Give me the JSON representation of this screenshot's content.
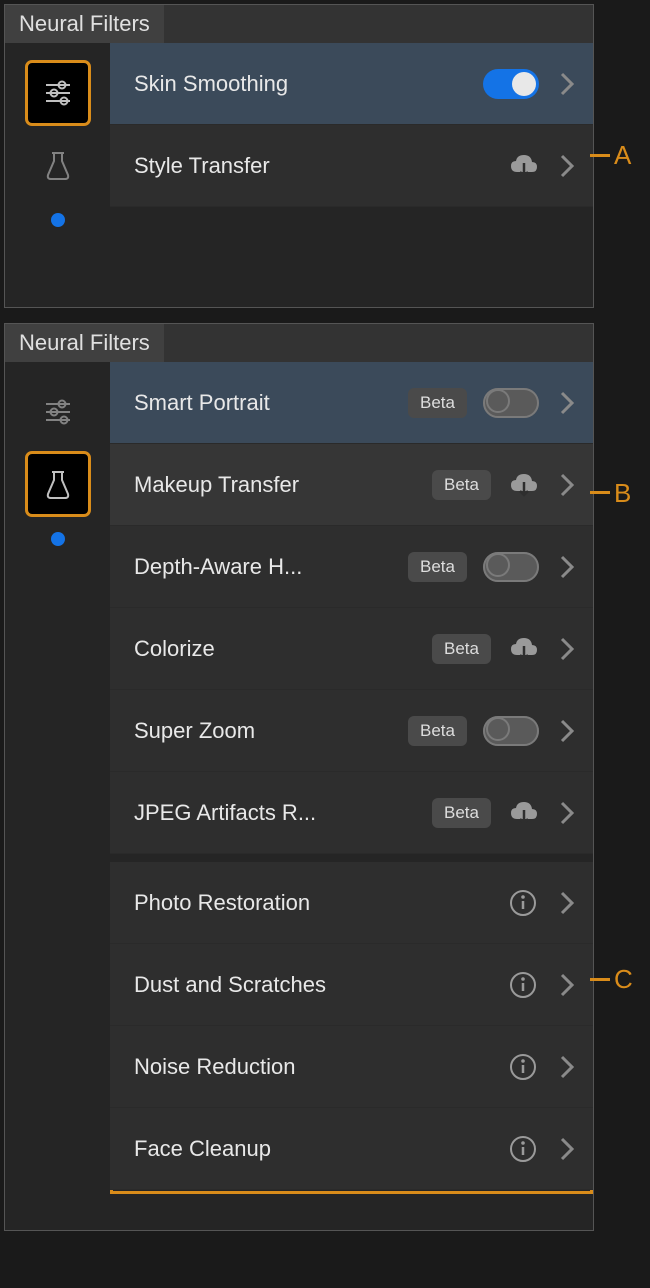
{
  "panel1": {
    "title": "Neural Filters",
    "rows": [
      {
        "label": "Skin Smoothing",
        "control": "toggle-on"
      },
      {
        "label": "Style Transfer",
        "control": "cloud"
      }
    ]
  },
  "panel2": {
    "title": "Neural Filters",
    "beta_text": "Beta",
    "rows_beta": [
      {
        "label": "Smart Portrait",
        "control": "toggle-off"
      },
      {
        "label": "Makeup Transfer",
        "control": "cloud"
      },
      {
        "label": "Depth-Aware H...",
        "control": "toggle-off"
      },
      {
        "label": "Colorize",
        "control": "cloud"
      },
      {
        "label": "Super Zoom",
        "control": "toggle-off"
      },
      {
        "label": "JPEG Artifacts R...",
        "control": "cloud"
      }
    ],
    "rows_info": [
      {
        "label": "Photo Restoration"
      },
      {
        "label": "Dust and Scratches"
      },
      {
        "label": "Noise Reduction"
      },
      {
        "label": "Face Cleanup"
      }
    ]
  },
  "annotations": {
    "a": "A",
    "b": "B",
    "c": "C"
  },
  "colors": {
    "accent": "#1473e6",
    "outline": "#d98c1a"
  }
}
